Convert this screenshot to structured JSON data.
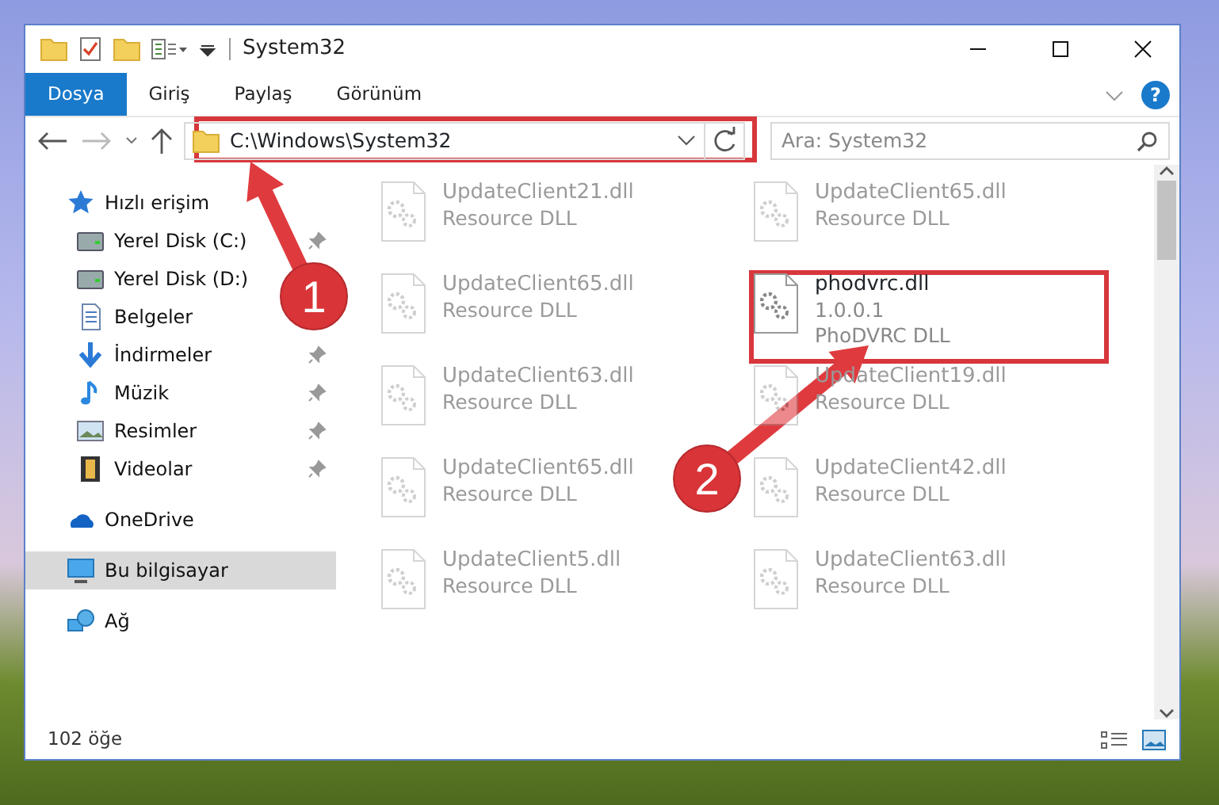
{
  "window": {
    "title": "System32"
  },
  "ribbon": {
    "tabs": [
      {
        "label": "Dosya",
        "selected": true
      },
      {
        "label": "Giriş",
        "selected": false
      },
      {
        "label": "Paylaş",
        "selected": false
      },
      {
        "label": "Görünüm",
        "selected": false
      }
    ],
    "help": "?"
  },
  "address_bar": {
    "path": "C:\\Windows\\System32"
  },
  "search": {
    "placeholder": "Ara: System32"
  },
  "sidebar": {
    "items": [
      {
        "label": "Hızlı erişim",
        "selected": false,
        "children": [
          {
            "label": "Yerel Disk (C:)",
            "pinned": true,
            "selected": false
          },
          {
            "label": "Yerel Disk (D:)",
            "selected": false
          },
          {
            "label": "Belgeler",
            "selected": false
          },
          {
            "label": "İndirmeler",
            "pinned": true,
            "selected": false
          },
          {
            "label": "Müzik",
            "pinned": true,
            "selected": false
          },
          {
            "label": "Resimler",
            "pinned": true,
            "selected": false
          },
          {
            "label": "Videolar",
            "pinned": true,
            "selected": false
          }
        ]
      },
      {
        "label": "OneDrive",
        "selected": false
      },
      {
        "label": "Bu bilgisayar",
        "selected": true
      },
      {
        "label": "Ağ",
        "selected": false
      }
    ]
  },
  "files": [
    {
      "name": "UpdateClient21.dll",
      "type": "Resource DLL",
      "dimmed": true
    },
    {
      "name": "UpdateClient65.dll",
      "type": "Resource DLL",
      "dimmed": true
    },
    {
      "name": "UpdateClient65.dll",
      "type": "Resource DLL",
      "dimmed": true
    },
    {
      "name": "phodvrc.dll",
      "version": "1.0.0.1",
      "type": "PhoDVRC DLL",
      "dimmed": false
    },
    {
      "name": "UpdateClient63.dll",
      "type": "Resource DLL",
      "dimmed": true
    },
    {
      "name": "UpdateClient19.dll",
      "type": "Resource DLL",
      "dimmed": true
    },
    {
      "name": "UpdateClient65.dll",
      "type": "Resource DLL",
      "dimmed": true
    },
    {
      "name": "UpdateClient42.dll",
      "type": "Resource DLL",
      "dimmed": true
    },
    {
      "name": "UpdateClient5.dll",
      "type": "Resource DLL",
      "dimmed": true
    },
    {
      "name": "UpdateClient63.dll",
      "type": "Resource DLL",
      "dimmed": true
    }
  ],
  "status_bar": {
    "count": "102 öğe"
  },
  "annotations": [
    {
      "label": "1"
    },
    {
      "label": "2"
    }
  ]
}
